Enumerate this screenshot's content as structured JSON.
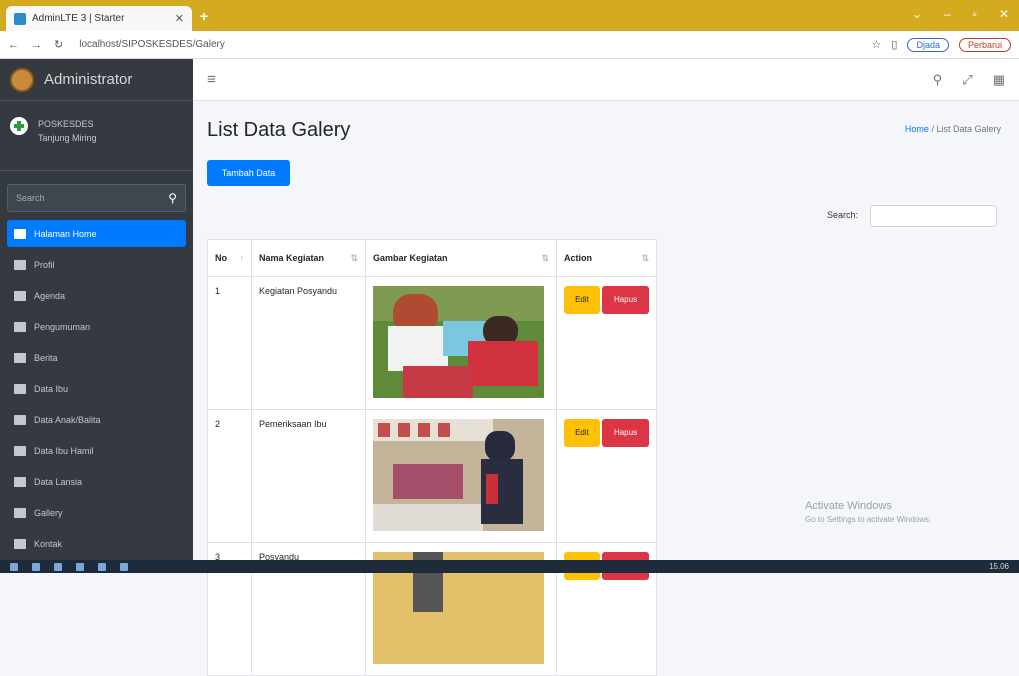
{
  "browser": {
    "tab_title": "AdminLTE 3 | Starter",
    "url": "localhost/SIPOSKESDES/Galery",
    "profile_label": "Djada",
    "update_label": "Perbarui"
  },
  "sidebar": {
    "brand": "Administrator",
    "user_name": "POSKESDES",
    "user_sub": "Tanjung Miring",
    "search_placeholder": "Search",
    "items": [
      {
        "label": "Halaman Home",
        "active": true
      },
      {
        "label": "Profil"
      },
      {
        "label": "Agenda"
      },
      {
        "label": "Pengumuman"
      },
      {
        "label": "Berita"
      },
      {
        "label": "Data Ibu"
      },
      {
        "label": "Data Anak/Balita"
      },
      {
        "label": "Data Ibu Hamil"
      },
      {
        "label": "Data Lansia"
      },
      {
        "label": "Gallery"
      },
      {
        "label": "Kontak"
      }
    ]
  },
  "page": {
    "title": "List Data Galery",
    "breadcrumb_home": "Home",
    "breadcrumb_current": "List Data Galery",
    "add_button": "Tambah Data",
    "search_label": "Search:"
  },
  "table": {
    "headers": [
      "No",
      "Nama Kegiatan",
      "Gambar Kegiatan",
      "Action"
    ],
    "rows": [
      {
        "no": "1",
        "nama": "Kegiatan Posyandu"
      },
      {
        "no": "2",
        "nama": "Pemeriksaan Ibu"
      },
      {
        "no": "3",
        "nama": "Posyandu"
      }
    ],
    "edit_label": "Edit",
    "delete_label": "Hapus"
  },
  "watermark": {
    "title": "Activate Windows",
    "sub": "Go to Settings to activate Windows."
  },
  "taskbar": {
    "time": "15.06"
  }
}
